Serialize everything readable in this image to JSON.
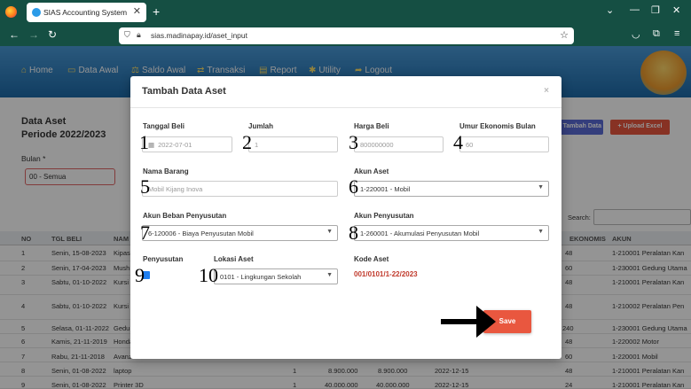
{
  "browser": {
    "tab_title": "SIAS Accounting System",
    "url": "sias.madinapay.id/aset_input"
  },
  "app_nav": [
    {
      "label": "Home",
      "icon": "home-icon"
    },
    {
      "label": "Data Awal",
      "icon": "monitor-icon"
    },
    {
      "label": "Saldo Awal",
      "icon": "balance-icon"
    },
    {
      "label": "Transaksi",
      "icon": "exchange-icon"
    },
    {
      "label": "Report",
      "icon": "chart-icon"
    },
    {
      "label": "Utility",
      "icon": "tools-icon"
    },
    {
      "label": "Logout",
      "icon": "logout-icon"
    }
  ],
  "page": {
    "title": "Data Aset",
    "period": "Periode 2022/2023",
    "bulan_label": "Bulan *",
    "bulan_value": "00 - Semua",
    "btn_tambah": "Tambah Data",
    "btn_upload": "+ Upload Excel",
    "search_label": "Search:"
  },
  "table": {
    "headers": {
      "no": "NO",
      "tgl": "TGL BELI",
      "nama": "NAM",
      "ekon": "EKONOMIS",
      "akun": "AKUN"
    },
    "rows": [
      {
        "no": "1",
        "tgl": "Senin, 15-08-2023",
        "nama": "Kipas",
        "ekon": "48",
        "akun": "1-210001 Peralatan Kan"
      },
      {
        "no": "2",
        "tgl": "Senin, 17-04-2023",
        "nama": "Mush",
        "ekon": "60",
        "akun": "1-230001 Gedung Utama"
      },
      {
        "no": "3",
        "tgl": "Sabtu, 01-10-2022",
        "nama": "Kursi",
        "ekon": "48",
        "akun": "1-210001 Peralatan Kan"
      },
      {
        "no": "4",
        "tgl": "Sabtu, 01-10-2022",
        "nama": "Kursi",
        "ekon": "48",
        "akun": "1-210002 Peralatan Pen"
      },
      {
        "no": "5",
        "tgl": "Selasa, 01-11-2022",
        "nama": "Gedu",
        "ekon": "240",
        "akun": "1-230001 Gedung Utama"
      },
      {
        "no": "6",
        "tgl": "Kamis, 21-11-2019",
        "nama": "Honda",
        "ekon": "48",
        "akun": "1-220002 Motor"
      },
      {
        "no": "7",
        "tgl": "Rabu, 21-11-2018",
        "nama": "Avanza 2018 2019",
        "ekon": "60",
        "akun": "1-220001 Mobil"
      },
      {
        "no": "8",
        "tgl": "Senin, 01-08-2022",
        "nama": "laptop",
        "jumlah": "1",
        "harga": "8.900.000",
        "total": "8.900.000",
        "tgl2": "2022-12-15",
        "ekon": "48",
        "akun": "1-210001 Peralatan Kan"
      },
      {
        "no": "9",
        "tgl": "Senin, 01-08-2022",
        "nama": "Printer 3D",
        "jumlah": "1",
        "harga": "40.000.000",
        "total": "40.000.000",
        "tgl2": "2022-12-15",
        "ekon": "24",
        "akun": "1-210001 Peralatan Kan"
      }
    ]
  },
  "modal": {
    "title": "Tambah Data Aset",
    "close": "×",
    "fields": {
      "tanggal_beli": {
        "label": "Tanggal Beli",
        "value": "2022-07-01"
      },
      "jumlah": {
        "label": "Jumlah",
        "value": "1"
      },
      "harga_beli": {
        "label": "Harga Beli",
        "value": "800000000"
      },
      "umur": {
        "label": "Umur Ekonomis Bulan",
        "value": "60"
      },
      "nama_barang": {
        "label": "Nama Barang",
        "value": "Mobil Kijang Inova"
      },
      "akun_aset": {
        "label": "Akun Aset",
        "value": "1-220001 - Mobil"
      },
      "akun_beban": {
        "label": "Akun Beban Penyusutan",
        "value": "6-120006 - Biaya Penyusutan Mobil"
      },
      "akun_penyusutan": {
        "label": "Akun Penyusutan",
        "value": "1-260001 - Akumulasi Penyusutan Mobil"
      },
      "penyusutan": {
        "label": "Penyusutan",
        "checked": true
      },
      "lokasi": {
        "label": "Lokasi Aset",
        "value": "0101 - Lingkungan Sekolah"
      },
      "kode": {
        "label": "Kode Aset",
        "value": "001/0101/1-22/2023"
      }
    },
    "save_label": "Save"
  },
  "annotations": [
    "1",
    "2",
    "3",
    "4",
    "5",
    "6",
    "7",
    "8",
    "9",
    "10"
  ],
  "colors": {
    "browser_chrome": "#154f43",
    "app_header": "#2f80c4",
    "save_button": "#e9573f",
    "tambah_button": "#5b6bd6",
    "kode_text": "#c0392b"
  }
}
